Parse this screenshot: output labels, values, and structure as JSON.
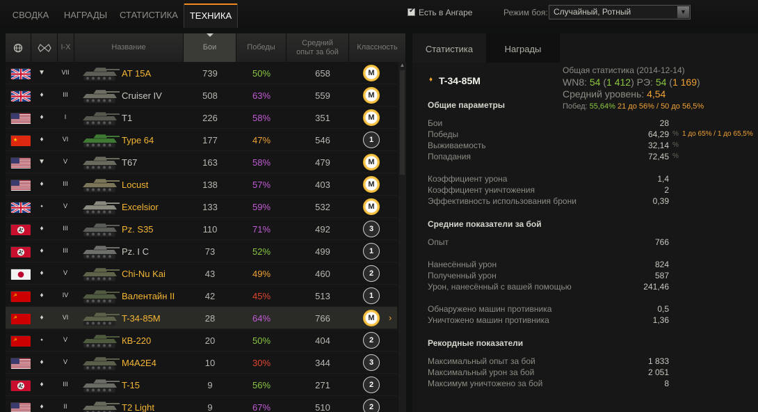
{
  "tabs": [
    "СВОДКА",
    "НАГРАДЫ",
    "СТАТИСТИКА",
    "ТЕХНИКА"
  ],
  "filters": {
    "hangar_label": "Есть в Ангаре",
    "mode_label": "Режим боя:",
    "mode_value": "Случайный, Ротный"
  },
  "columns": {
    "tier": "I-X",
    "name": "Название",
    "battles": "Бои",
    "wins": "Победы",
    "xp": "Средний опыт за бой",
    "mastery": "Классность"
  },
  "vehicles": [
    {
      "nation": "uk",
      "type": "▼",
      "tier": "VII",
      "name": "AT 15A",
      "gold": true,
      "battles": "739",
      "wins": "50%",
      "win_color": "#8cc63f",
      "xp": "658",
      "mastery": "M",
      "tank_color": "#5d5f56"
    },
    {
      "nation": "uk",
      "type": "♦",
      "tier": "III",
      "name": "Cruiser IV",
      "gold": false,
      "battles": "508",
      "wins": "63%",
      "win_color": "#c25bd6",
      "xp": "559",
      "mastery": "M",
      "tank_color": "#6e6e64"
    },
    {
      "nation": "us",
      "type": "♦",
      "tier": "I",
      "name": "T1",
      "gold": false,
      "battles": "226",
      "wins": "58%",
      "win_color": "#c25bd6",
      "xp": "351",
      "mastery": "M",
      "tank_color": "#56574e"
    },
    {
      "nation": "cn",
      "type": "♦",
      "tier": "VI",
      "name": "Type 64",
      "gold": true,
      "battles": "177",
      "wins": "47%",
      "win_color": "#f1a234",
      "xp": "546",
      "mastery": "1",
      "tank_color": "#3f7a34"
    },
    {
      "nation": "us",
      "type": "▼",
      "tier": "V",
      "name": "T67",
      "gold": false,
      "battles": "163",
      "wins": "58%",
      "win_color": "#c25bd6",
      "xp": "479",
      "mastery": "M",
      "tank_color": "#6a6a5e"
    },
    {
      "nation": "us",
      "type": "♦",
      "tier": "III",
      "name": "Locust",
      "gold": true,
      "battles": "138",
      "wins": "57%",
      "win_color": "#c25bd6",
      "xp": "403",
      "mastery": "M",
      "tank_color": "#7b7659"
    },
    {
      "nation": "uk",
      "type": "⬩",
      "tier": "V",
      "name": "Excelsior",
      "gold": true,
      "battles": "133",
      "wins": "59%",
      "win_color": "#c25bd6",
      "xp": "532",
      "mastery": "M",
      "tank_color": "#8a8a80"
    },
    {
      "nation": "de",
      "type": "♦",
      "tier": "III",
      "name": "Pz. S35",
      "gold": true,
      "battles": "110",
      "wins": "71%",
      "win_color": "#c25bd6",
      "xp": "492",
      "mastery": "3",
      "tank_color": "#5b5d59"
    },
    {
      "nation": "de",
      "type": "♦",
      "tier": "III",
      "name": "Pz. I C",
      "gold": false,
      "battles": "73",
      "wins": "52%",
      "win_color": "#8cc63f",
      "xp": "499",
      "mastery": "1",
      "tank_color": "#6d6f6b"
    },
    {
      "nation": "jp",
      "type": "♦",
      "tier": "V",
      "name": "Chi-Nu Kai",
      "gold": true,
      "battles": "43",
      "wins": "49%",
      "win_color": "#f1a234",
      "xp": "460",
      "mastery": "2",
      "tank_color": "#5f6349"
    },
    {
      "nation": "su",
      "type": "♦",
      "tier": "IV",
      "name": "Валентайн II",
      "gold": true,
      "battles": "42",
      "wins": "45%",
      "win_color": "#e0452f",
      "xp": "513",
      "mastery": "1",
      "tank_color": "#4f5a40"
    },
    {
      "nation": "su",
      "type": "♦",
      "tier": "VI",
      "name": "T-34-85M",
      "gold": true,
      "battles": "28",
      "wins": "64%",
      "win_color": "#c25bd6",
      "xp": "766",
      "mastery": "M",
      "tank_color": "#5c6149",
      "selected": true
    },
    {
      "nation": "su",
      "type": "⬩",
      "tier": "V",
      "name": "КВ-220",
      "gold": true,
      "battles": "20",
      "wins": "50%",
      "win_color": "#8cc63f",
      "xp": "404",
      "mastery": "2",
      "tank_color": "#4e5a3d"
    },
    {
      "nation": "us",
      "type": "♦",
      "tier": "V",
      "name": "M4A2E4",
      "gold": true,
      "battles": "10",
      "wins": "30%",
      "win_color": "#e0452f",
      "xp": "344",
      "mastery": "3",
      "tank_color": "#5a5f4b"
    },
    {
      "nation": "de",
      "type": "♦",
      "tier": "III",
      "name": "T-15",
      "gold": true,
      "battles": "9",
      "wins": "56%",
      "win_color": "#8cc63f",
      "xp": "271",
      "mastery": "2",
      "tank_color": "#6a6c66"
    },
    {
      "nation": "us",
      "type": "♦",
      "tier": "II",
      "name": "T2 Light",
      "gold": true,
      "battles": "9",
      "wins": "67%",
      "win_color": "#c25bd6",
      "xp": "510",
      "mastery": "2",
      "tank_color": "#6a6b5f"
    }
  ],
  "panel": {
    "tab_stats": "Статистика",
    "tab_awards": "Награды",
    "vehicle_name": "T-34-85M",
    "overall_title": "Общая статистика (2014-12-14)",
    "wn8_label": "WN8:",
    "wn8_value": "54",
    "wn8_extra": "1 412",
    "re_label": "РЭ:",
    "re_value": "54",
    "re_extra": "1 169",
    "avg_level_label": "Средний уровень:",
    "avg_level_value": "4,54",
    "wins_line_label": "Побед:",
    "wins_line_value": "55,64%",
    "wins_line_rest": "21 до 56% / 50 до 56,5%",
    "general_title": "Общие параметры",
    "general": [
      {
        "label": "Бои",
        "value": "28"
      },
      {
        "label": "Победы",
        "value": "64,29",
        "pct": "%",
        "extra": "1 до 65% / 1 до 65,5%"
      },
      {
        "label": "Выживаемость",
        "value": "32,14",
        "pct": "%"
      },
      {
        "label": "Попадания",
        "value": "72,45",
        "pct": "%"
      }
    ],
    "coeffs": [
      {
        "label": "Коэффициент урона",
        "value": "1,4"
      },
      {
        "label": "Коэффициент уничтожения",
        "value": "2"
      },
      {
        "label": "Эффективность использования брони",
        "value": "0,39"
      }
    ],
    "avg_title": "Средние показатели за бой",
    "avg_xp": {
      "label": "Опыт",
      "value": "766"
    },
    "avg_damage": [
      {
        "label": "Нанесённый урон",
        "value": "824"
      },
      {
        "label": "Полученный урон",
        "value": "587"
      },
      {
        "label": "Урон, нанесённый с вашей помощью",
        "value": "241,46"
      }
    ],
    "avg_enemy": [
      {
        "label": "Обнаружено машин противника",
        "value": "0,5"
      },
      {
        "label": "Уничтожено машин противника",
        "value": "1,36"
      }
    ],
    "record_title": "Рекордные показатели",
    "records": [
      {
        "label": "Максимальный опыт за бой",
        "value": "1 833"
      },
      {
        "label": "Максимальный урон за бой",
        "value": "2 051"
      },
      {
        "label": "Максимум уничтожено за бой",
        "value": "8"
      }
    ]
  }
}
